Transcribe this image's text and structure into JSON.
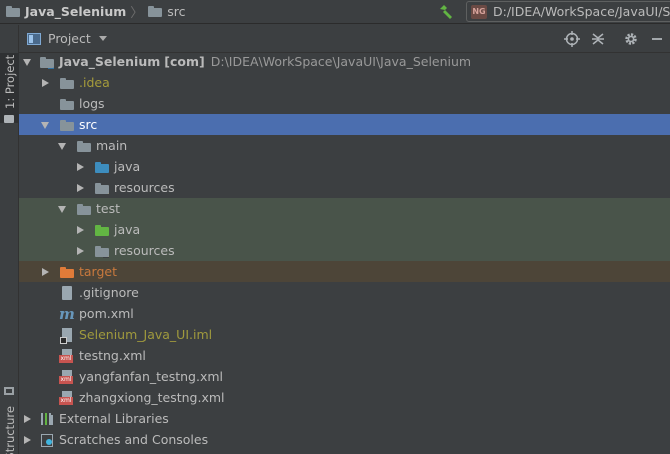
{
  "navbar": {
    "project_name": "Java_Selenium",
    "current_folder": "src",
    "run_config_badge": "NG",
    "run_config_path": "D:/IDEA/WorkSpace/JavaUI/Se"
  },
  "side_strip": {
    "project_tab": "1: Project",
    "structure_tab": "Z: Structure"
  },
  "panel": {
    "title": "Project",
    "buttons": [
      "locate-icon",
      "collapse-all-icon",
      "settings-icon",
      "hide-icon"
    ]
  },
  "tree": {
    "root_name": "Java_Selenium",
    "root_module": "[com]",
    "root_path": "D:\\IDEA\\WorkSpace\\JavaUI\\Java_Selenium",
    "idea": ".idea",
    "logs": "logs",
    "src": "src",
    "main": "main",
    "main_java": "java",
    "main_resources": "resources",
    "test": "test",
    "test_java": "java",
    "test_resources": "resources",
    "target": "target",
    "gitignore": ".gitignore",
    "pom": "pom.xml",
    "iml": "Selenium_Java_UI.iml",
    "testng": "testng.xml",
    "yang_testng": "yangfanfan_testng.xml",
    "zhang_testng": "zhangxiong_testng.xml",
    "external_libraries": "External Libraries",
    "scratches": "Scratches and Consoles"
  },
  "colors": {
    "selection": "#4b6eaf",
    "test_row": "#49544a",
    "excluded_row": "#4d4538"
  }
}
